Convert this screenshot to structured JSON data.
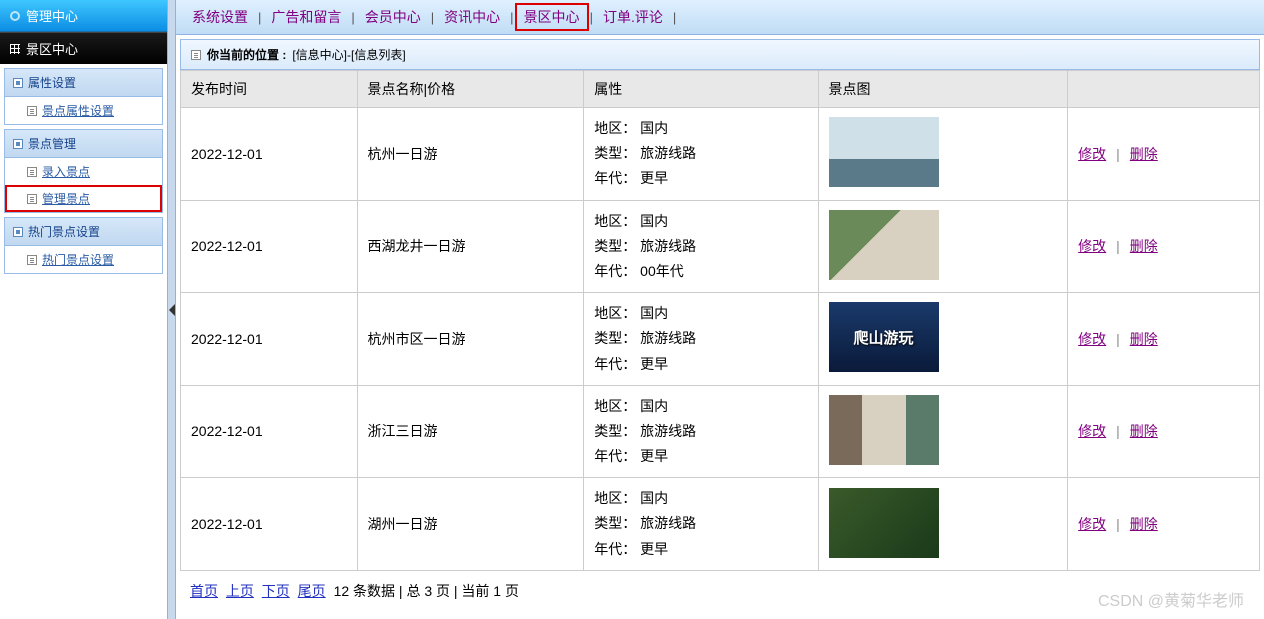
{
  "sidebar": {
    "header": "管理中心",
    "section": "景区中心",
    "groups": [
      {
        "title": "属性设置",
        "items": [
          {
            "label": "景点属性设置",
            "hl": false
          }
        ]
      },
      {
        "title": "景点管理",
        "items": [
          {
            "label": "录入景点",
            "hl": false
          },
          {
            "label": "管理景点",
            "hl": true
          }
        ]
      },
      {
        "title": "热门景点设置",
        "items": [
          {
            "label": "热门景点设置",
            "hl": false
          }
        ]
      }
    ]
  },
  "topnav": {
    "items": [
      {
        "label": "系统设置",
        "hl": false
      },
      {
        "label": "广告和留言",
        "hl": false
      },
      {
        "label": "会员中心",
        "hl": false
      },
      {
        "label": "资讯中心",
        "hl": false
      },
      {
        "label": "景区中心",
        "hl": true
      },
      {
        "label": "订单.评论",
        "hl": false
      }
    ]
  },
  "breadcrumb": {
    "prefix": "你当前的位置 :",
    "path": "[信息中心]-[信息列表]"
  },
  "table": {
    "headers": [
      "发布时间",
      "景点名称|价格",
      "属性",
      "景点图",
      ""
    ],
    "attr_labels": {
      "region": "地区：",
      "type": "类型：",
      "era": "年代："
    },
    "rows": [
      {
        "date": "2022-12-01",
        "name": "杭州一日游",
        "region": "国内",
        "type": "旅游线路",
        "era": "更早",
        "img_hint": ""
      },
      {
        "date": "2022-12-01",
        "name": "西湖龙井一日游",
        "region": "国内",
        "type": "旅游线路",
        "era": "00年代",
        "img_hint": ""
      },
      {
        "date": "2022-12-01",
        "name": "杭州市区一日游",
        "region": "国内",
        "type": "旅游线路",
        "era": "更早",
        "img_hint": "爬山游玩"
      },
      {
        "date": "2022-12-01",
        "name": "浙江三日游",
        "region": "国内",
        "type": "旅游线路",
        "era": "更早",
        "img_hint": ""
      },
      {
        "date": "2022-12-01",
        "name": "湖州一日游",
        "region": "国内",
        "type": "旅游线路",
        "era": "更早",
        "img_hint": ""
      }
    ],
    "actions": {
      "edit": "修改",
      "delete": "删除"
    }
  },
  "pager": {
    "first": "首页",
    "prev": "上页",
    "next": "下页",
    "last": "尾页",
    "summary": "12 条数据 | 总 3 页 | 当前 1 页"
  },
  "watermark": "CSDN @黄菊华老师"
}
